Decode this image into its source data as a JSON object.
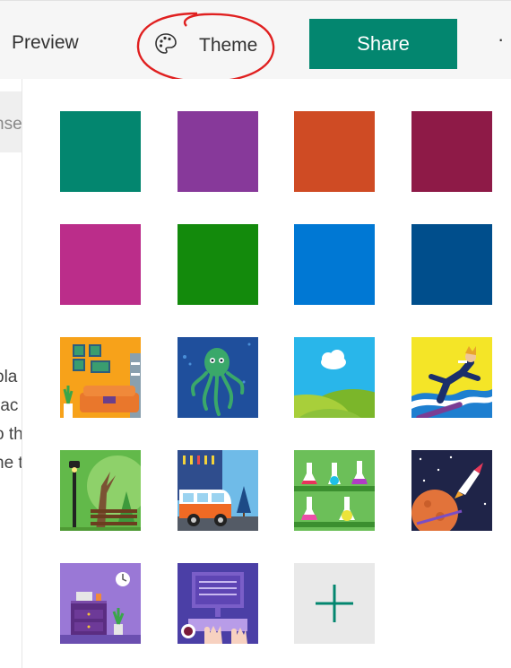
{
  "toolbar": {
    "preview_label": "Preview",
    "theme_label": "Theme",
    "share_label": "Share",
    "more_label": "·",
    "accent": "#03866f",
    "annotation_color": "#e02020"
  },
  "left_fragments": [
    "nse",
    "pla",
    "rac",
    "o th",
    "ne t"
  ],
  "themes": {
    "colors": [
      "#03866f",
      "#87399a",
      "#cf4b24",
      "#8e1a47",
      "#bb2d8a",
      "#138a0c",
      "#0078d4",
      "#004e8c"
    ],
    "images": [
      "living-room",
      "octopus",
      "hills-cloud",
      "snowboarder",
      "park-bench",
      "camper-van",
      "lab-flasks",
      "space-planet",
      "bedroom-desk",
      "keyboard-typing"
    ],
    "add_icon": "plus-icon"
  }
}
